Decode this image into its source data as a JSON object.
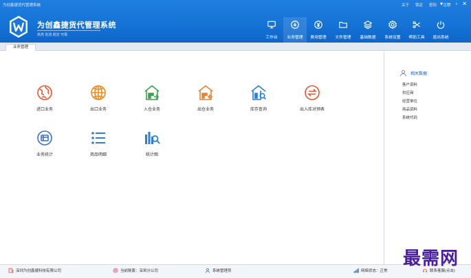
{
  "window": {
    "title": "为创鑫捷货代管理系统",
    "links": [
      "关于",
      "锁定",
      "密码",
      "注销"
    ],
    "controls": [
      "▾",
      "–",
      "▫",
      "✕"
    ]
  },
  "app": {
    "name": "为创鑫捷货代管理系统",
    "tagline": "高亮 省流 稳定 可靠"
  },
  "topnav": [
    {
      "label": "工作台",
      "icon": "monitor-icon"
    },
    {
      "label": "业务管理",
      "icon": "download-circle-icon"
    },
    {
      "label": "费用管理",
      "icon": "yen-circle-icon"
    },
    {
      "label": "文件管理",
      "icon": "folder-icon"
    },
    {
      "label": "基础数据",
      "icon": "layers-icon"
    },
    {
      "label": "系统设置",
      "icon": "gear-icon"
    },
    {
      "label": "帮助工具",
      "icon": "scissors-icon"
    },
    {
      "label": "退出系统",
      "icon": "power-icon"
    }
  ],
  "tabs": {
    "active": "业务管理"
  },
  "modules": [
    {
      "label": "进口业务",
      "icon": "import-globe-icon",
      "color": "#e9532e"
    },
    {
      "label": "出口业务",
      "icon": "export-globe-icon",
      "color": "#f08a1c"
    },
    {
      "label": "入仓业务",
      "icon": "warehouse-in-icon",
      "color": "#3aa24a"
    },
    {
      "label": "出仓业务",
      "icon": "warehouse-out-icon",
      "color": "#e9832e"
    },
    {
      "label": "库存查询",
      "icon": "warehouse-search-icon",
      "color": "#2b7fd6"
    },
    {
      "label": "出入库对预表",
      "icon": "exchange-circle-icon",
      "color": "#e9532e"
    },
    {
      "label": "业务统计",
      "icon": "stats-circle-icon",
      "color": "#3b6ed1"
    },
    {
      "label": "商品明细",
      "icon": "list-icon",
      "color": "#2b7fd6"
    },
    {
      "label": "统计图",
      "icon": "chart-search-icon",
      "color": "#2b7fd6"
    }
  ],
  "related": {
    "title": "相关数据",
    "items": [
      "客户资料",
      "供应商",
      "经营单位",
      "商品资料",
      "系统代码"
    ]
  },
  "status": {
    "company": "深圳为创鑫捷科技有限公司",
    "account": "当前账套：深圳分公司",
    "user": "系统管理员",
    "network": "网络状态：正常",
    "contact": "联系客服(点击)"
  },
  "watermark": "最需网",
  "colors": {
    "brand_blue": "#1572d6",
    "link_blue": "#1a5fb4"
  }
}
